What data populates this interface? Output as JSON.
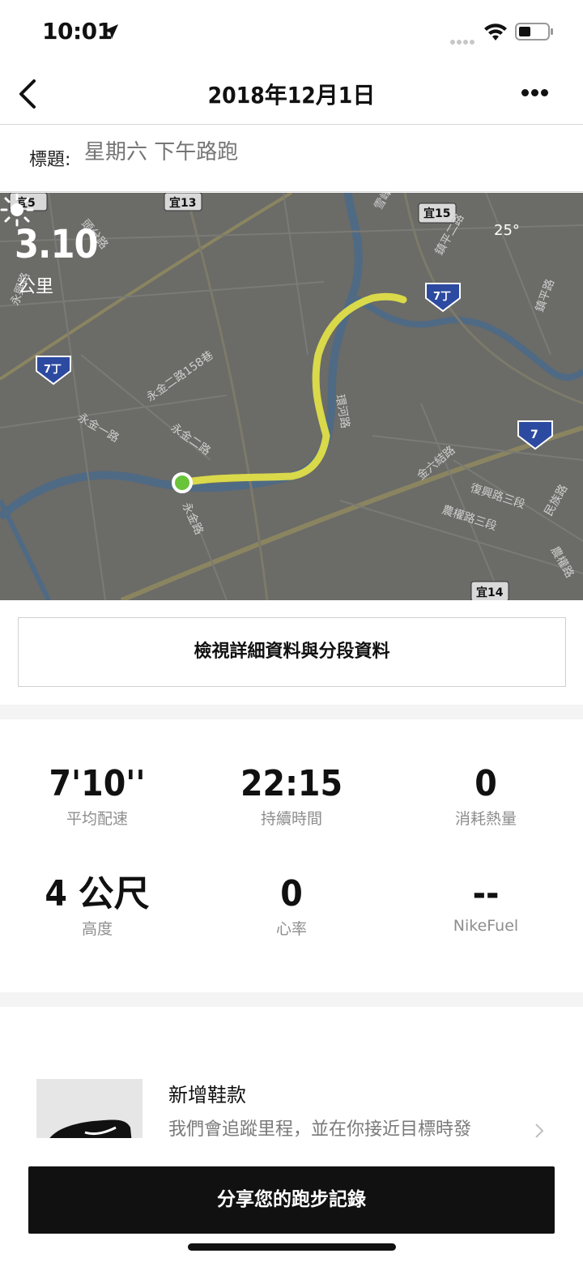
{
  "status_bar": {
    "time": "10:01"
  },
  "nav": {
    "title": "2018年12月1日"
  },
  "title_row": {
    "label": "標題:",
    "placeholder": "星期六 下午路跑"
  },
  "map": {
    "distance": "3.10",
    "distance_unit": "公里",
    "temperature": "25°",
    "route_color": "#d9d94a",
    "start_color": "#6ac43a",
    "road_labels": [
      "宜5",
      "宜13",
      "宜15",
      "7丁",
      "7丁",
      "7",
      "宜14",
      "永金一路",
      "永金二路",
      "永金二路158巷",
      "環河路",
      "金六結路",
      "復興路三段",
      "農權路三段",
      "民族路",
      "鎮平二路",
      "頭分路",
      "永興路",
      "永金路",
      "雪峰路",
      "鎮平路"
    ]
  },
  "details_button": "檢視詳細資料與分段資料",
  "stats": [
    {
      "value": "7'10''",
      "label": "平均配速"
    },
    {
      "value": "22:15",
      "label": "持續時間"
    },
    {
      "value": "0",
      "label": "消耗熱量"
    },
    {
      "value": "4 公尺",
      "label": "高度"
    },
    {
      "value": "0",
      "label": "心率"
    },
    {
      "value": "--",
      "label": "NikeFuel"
    }
  ],
  "shoe_card": {
    "title": "新增鞋款",
    "description": "我們會追蹤里程，並在你接近目標時發"
  },
  "share_button": "分享您的跑步記錄"
}
